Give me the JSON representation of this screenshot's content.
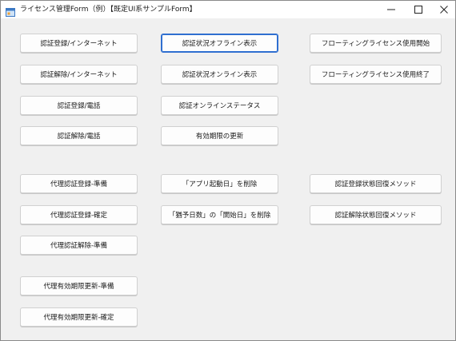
{
  "window": {
    "title": "ライセンス管理Form（例）【既定UI系サンプルForm】"
  },
  "column1": {
    "btn_auth_register_internet": "認証登録/インターネット",
    "btn_auth_release_internet": "認証解除/インターネット",
    "btn_auth_register_phone": "認証登録/電話",
    "btn_auth_release_phone": "認証解除/電話",
    "btn_proxy_register_prepare": "代理認証登録-準備",
    "btn_proxy_register_confirm": "代理認証登録-確定",
    "btn_proxy_release_prepare": "代理認証解除-準備",
    "btn_proxy_extend_prepare": "代理有効期限更新-準備",
    "btn_proxy_extend_confirm": "代理有効期限更新-確定"
  },
  "column2": {
    "btn_status_offline": "認証状況オフライン表示",
    "btn_status_online": "認証状況オンライン表示",
    "btn_online_status": "認証オンラインステータス",
    "btn_expiry_update": "有効期限の更新",
    "btn_delete_app_start_date": "「アプリ起動日」を削除",
    "btn_delete_grace_days": "「猶予日数」の「開始日」を削除"
  },
  "column3": {
    "btn_floating_start": "フローティングライセンス使用開始",
    "btn_floating_end": "フローティングライセンス使用終了",
    "btn_register_recovery": "認証登録状態回復メソッド",
    "btn_release_recovery": "認証解除状態回復メソッド"
  },
  "colors": {
    "background": "#f0f0f0",
    "button_face": "#fdfdfd",
    "focus_border": "#2f6fd0"
  }
}
